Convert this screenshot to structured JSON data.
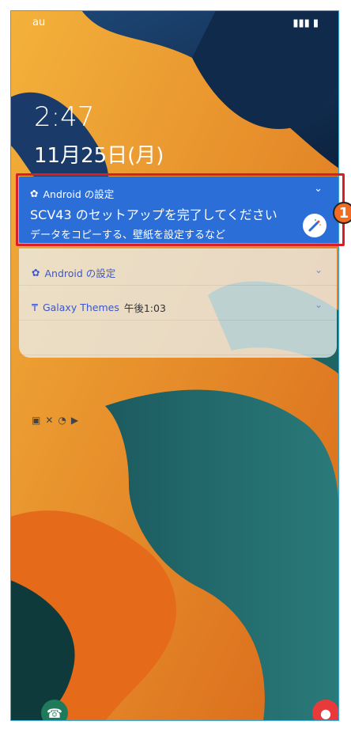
{
  "status": {
    "carrier": "au"
  },
  "lock": {
    "time": "2:47",
    "date": "11月25日(月)"
  },
  "notifications": {
    "main": {
      "app": "Android の設定",
      "title": "SCV43 のセットアップを完了してください",
      "desc": "データをコピーする、壁紙を設定するなど"
    },
    "second": {
      "app": "Android の設定"
    },
    "third": {
      "app": "Galaxy Themes",
      "time": "午後1:03"
    }
  },
  "annotation": {
    "number": "1"
  },
  "colors": {
    "accent": "#2b6ed8",
    "highlight": "#d61f28",
    "callout": "#f26b22"
  },
  "icons": {
    "status": [
      "signal-icon",
      "battery-icon"
    ],
    "row_icons": [
      "gear-icon",
      "galaxy-themes-icon",
      "image-icon",
      "tools-icon",
      "arrow-icon",
      "play-icon"
    ],
    "shortcuts": [
      "phone-icon",
      "camera-icon"
    ]
  }
}
